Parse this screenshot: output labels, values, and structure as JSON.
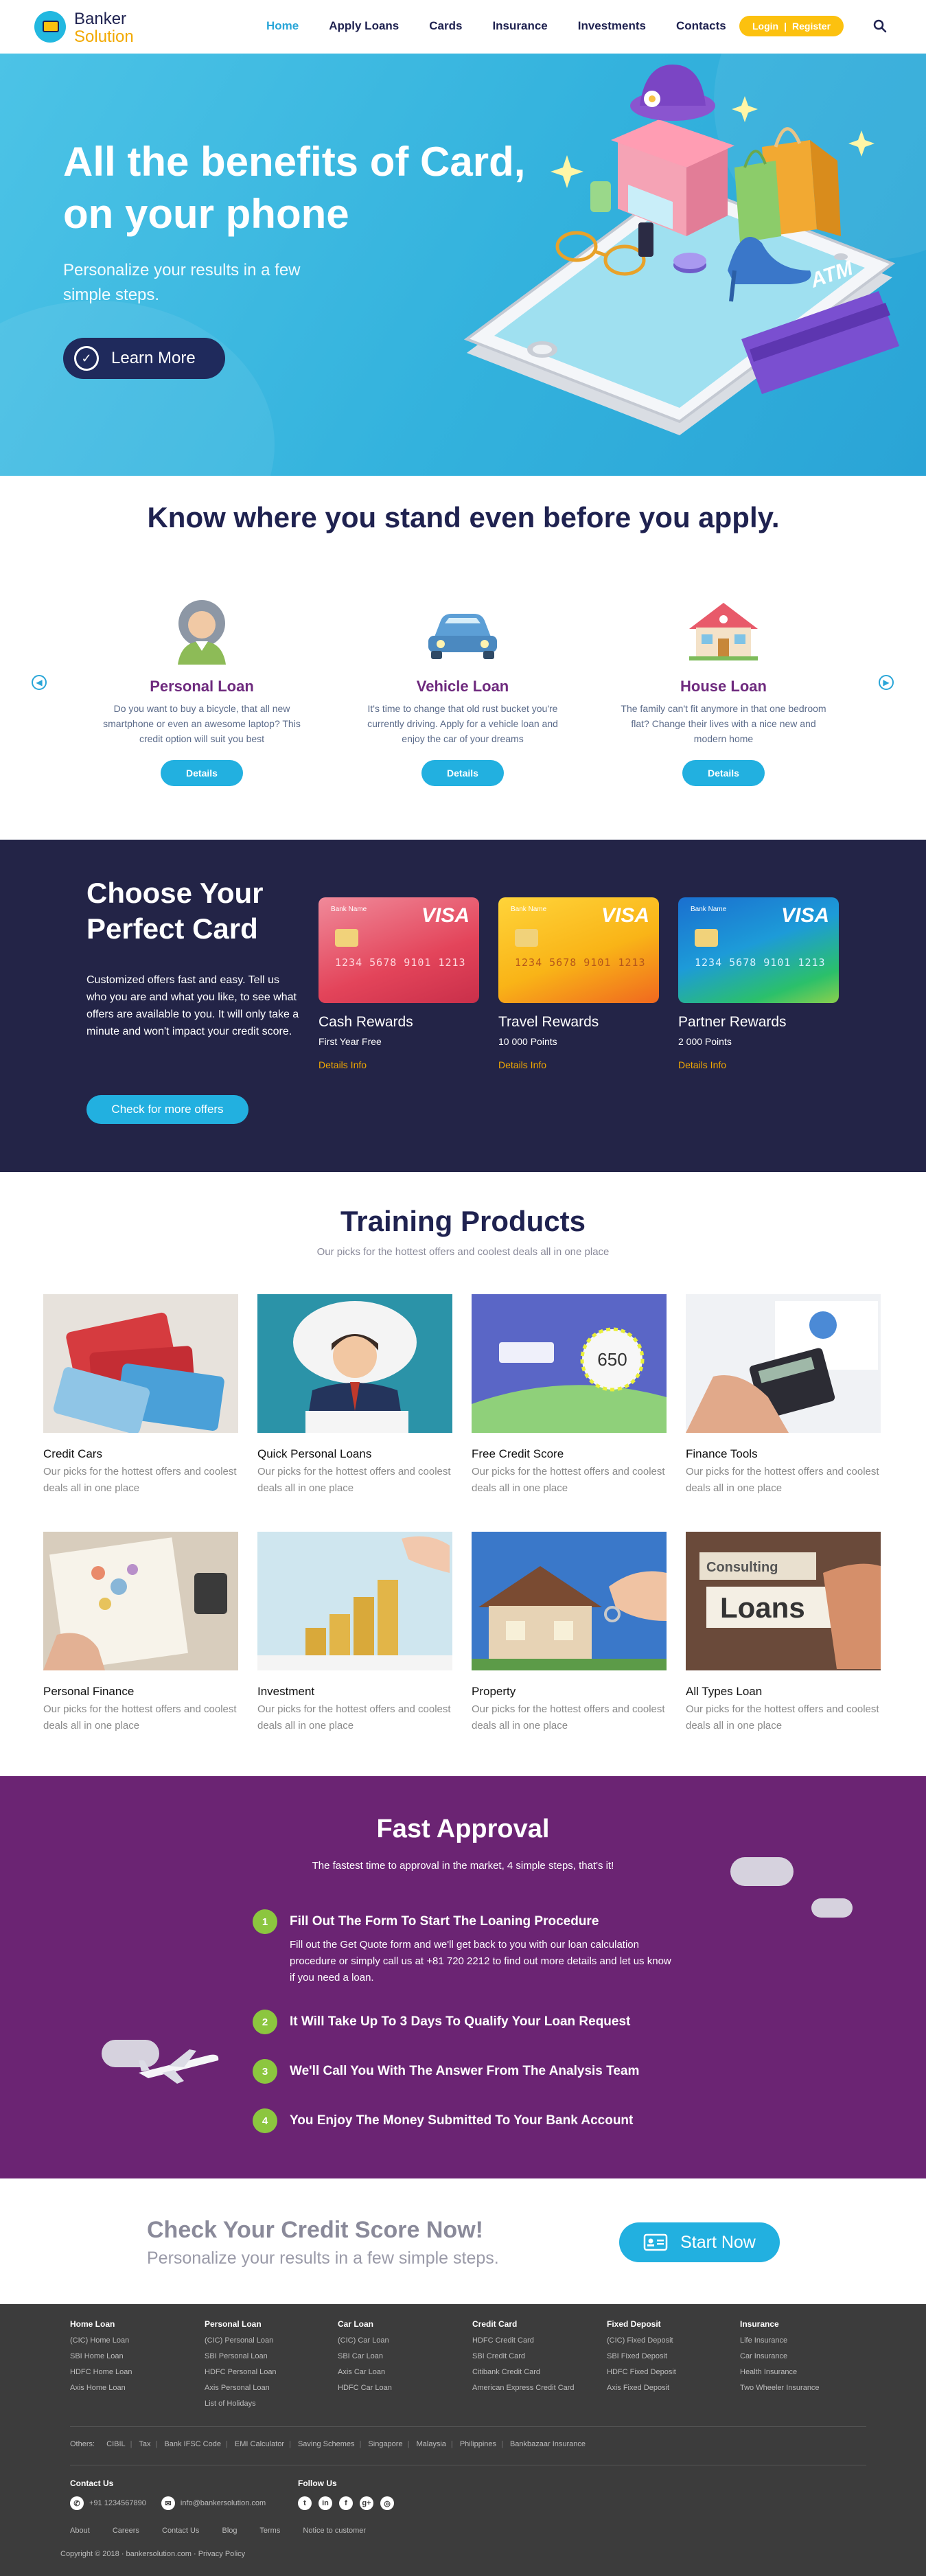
{
  "header": {
    "brand_line1": "Banker",
    "brand_line2": "Solution",
    "nav": [
      "Home",
      "Apply Loans",
      "Cards",
      "Insurance",
      "Investments",
      "Contacts"
    ],
    "login_label": "Login",
    "register_label": "Register"
  },
  "hero": {
    "title_line1": "All the benefits of Card,",
    "title_line2": "on your phone",
    "subtitle": "Personalize your results in a few simple steps.",
    "cta": "Learn More",
    "atm_text": "ATM"
  },
  "stand": {
    "title": "Know where you stand even before you apply.",
    "loans": [
      {
        "title": "Personal Loan",
        "text": "Do you want to buy a bicycle, that all new smartphone or even an awesome laptop? This credit option will suit you best",
        "button": "Details"
      },
      {
        "title": "Vehicle Loan",
        "text": "It's time to change that old rust bucket you're currently driving. Apply for a vehicle loan and enjoy the car of your dreams",
        "button": "Details"
      },
      {
        "title": "House Loan",
        "text": "The family can't fit anymore in that one bedroom flat? Change their lives with a nice new and modern home",
        "button": "Details"
      }
    ]
  },
  "choose": {
    "title_line1": "Choose Your",
    "title_line2": "Perfect Card",
    "text": "Customized offers fast and easy. Tell us who you are and what you like, to see what offers are available to you. It will only take a minute and won't impact your credit score.",
    "cta": "Check for more offers",
    "cards": [
      {
        "title": "Cash Rewards",
        "sub": "First Year Free",
        "link": "Details Info",
        "number": "1234 5678 9101 1213",
        "bank": "Bank Name",
        "visa": "VISA"
      },
      {
        "title": "Travel Rewards",
        "sub": "10 000 Points",
        "link": "Details Info",
        "number": "1234 5678 9101 1213",
        "bank": "Bank Name",
        "visa": "VISA"
      },
      {
        "title": "Partner Rewards",
        "sub": "2 000 Points",
        "link": "Details Info",
        "number": "1234 5678 9101 1213",
        "bank": "Bank Name",
        "visa": "VISA"
      }
    ]
  },
  "training": {
    "title": "Training Products",
    "subtitle": "Our picks for the hottest offers and coolest deals all in one place",
    "products": [
      {
        "title": "Credit Cars",
        "text": "Our picks for the hottest offers and coolest deals all in one place"
      },
      {
        "title": "Quick Personal Loans",
        "text": "Our picks for the hottest offers and coolest deals all in one place"
      },
      {
        "title": "Free Credit Score",
        "text": "Our picks for the hottest offers and coolest deals all in one place"
      },
      {
        "title": "Finance Tools",
        "text": "Our picks for the hottest offers and coolest deals all in one place"
      },
      {
        "title": "Personal Finance",
        "text": "Our picks for the hottest offers and coolest deals all in one place"
      },
      {
        "title": "Investment",
        "text": "Our picks for the hottest offers and coolest deals all in one place"
      },
      {
        "title": "Property",
        "text": "Our picks for the hottest offers and coolest deals all in one place"
      },
      {
        "title": "All Types Loan",
        "text": "Our picks for the hottest offers and coolest deals all in one place"
      }
    ],
    "score_value": "650",
    "loans_sign": "Loans",
    "consulting_sign": "Consulting"
  },
  "fast": {
    "title": "Fast Approval",
    "lead": "The fastest time to approval in the market, 4 simple steps, that's it!",
    "steps": [
      {
        "n": "1",
        "title": "Fill Out The Form To Start The Loaning Procedure",
        "text": "Fill out the Get Quote form and we'll get back to you with our loan calculation procedure or simply call us at +81 720 2212 to find out more details and let us know if you need a loan."
      },
      {
        "n": "2",
        "title": "It Will Take Up To 3 Days To Qualify Your Loan Request",
        "text": ""
      },
      {
        "n": "3",
        "title": "We'll Call You With The Answer From The Analysis Team",
        "text": ""
      },
      {
        "n": "4",
        "title": "You Enjoy The Money Submitted To Your Bank Account",
        "text": ""
      }
    ]
  },
  "credit": {
    "title": "Check Your Credit Score Now!",
    "subtitle": "Personalize your results in a few simple steps.",
    "cta": "Start Now"
  },
  "footer": {
    "columns": [
      {
        "title": "Home Loan",
        "items": [
          "(CIC) Home Loan",
          "SBI Home Loan",
          "HDFC Home Loan",
          "Axis Home Loan"
        ]
      },
      {
        "title": "Personal Loan",
        "items": [
          "(CIC) Personal Loan",
          "SBI Personal Loan",
          "HDFC Personal Loan",
          "Axis Personal Loan",
          "List of Holidays"
        ]
      },
      {
        "title": "Car Loan",
        "items": [
          "(CIC) Car Loan",
          "SBI Car Loan",
          "Axis Car Loan",
          "HDFC Car Loan"
        ]
      },
      {
        "title": "Credit Card",
        "items": [
          "HDFC Credit Card",
          "SBI Credit Card",
          "Citibank Credit Card",
          "American Express Credit Card"
        ]
      },
      {
        "title": "Fixed Deposit",
        "items": [
          "(CIC) Fixed Deposit",
          "SBI Fixed Deposit",
          "HDFC Fixed Deposit",
          "Axis Fixed Deposit"
        ]
      },
      {
        "title": "Insurance",
        "items": [
          "Life Insurance",
          "Car Insurance",
          "Health Insurance",
          "Two Wheeler Insurance"
        ]
      }
    ],
    "links": [
      "Others:",
      "CIBIL",
      "Tax",
      "Bank IFSC Code",
      "EMI Calculator",
      "Saving Schemes",
      "Singapore",
      "Malaysia",
      "Philippines",
      "Bankbazaar Insurance"
    ],
    "contact_title": "Contact Us",
    "phone": "+91 1234567890",
    "email": "info@bankersolution.com",
    "follow_title": "Follow Us",
    "bottom_links": [
      "About",
      "Careers",
      "Contact Us",
      "Blog",
      "Terms",
      "Notice to customer"
    ],
    "copyright": "Copyright © 2018 · bankersolution.com · Privacy Policy"
  },
  "colors": {
    "brand_blue": "#22b0e0",
    "navy": "#1f2250",
    "yellow": "#fcc10f",
    "purple": "#6b2473",
    "green": "#8cc63f"
  }
}
